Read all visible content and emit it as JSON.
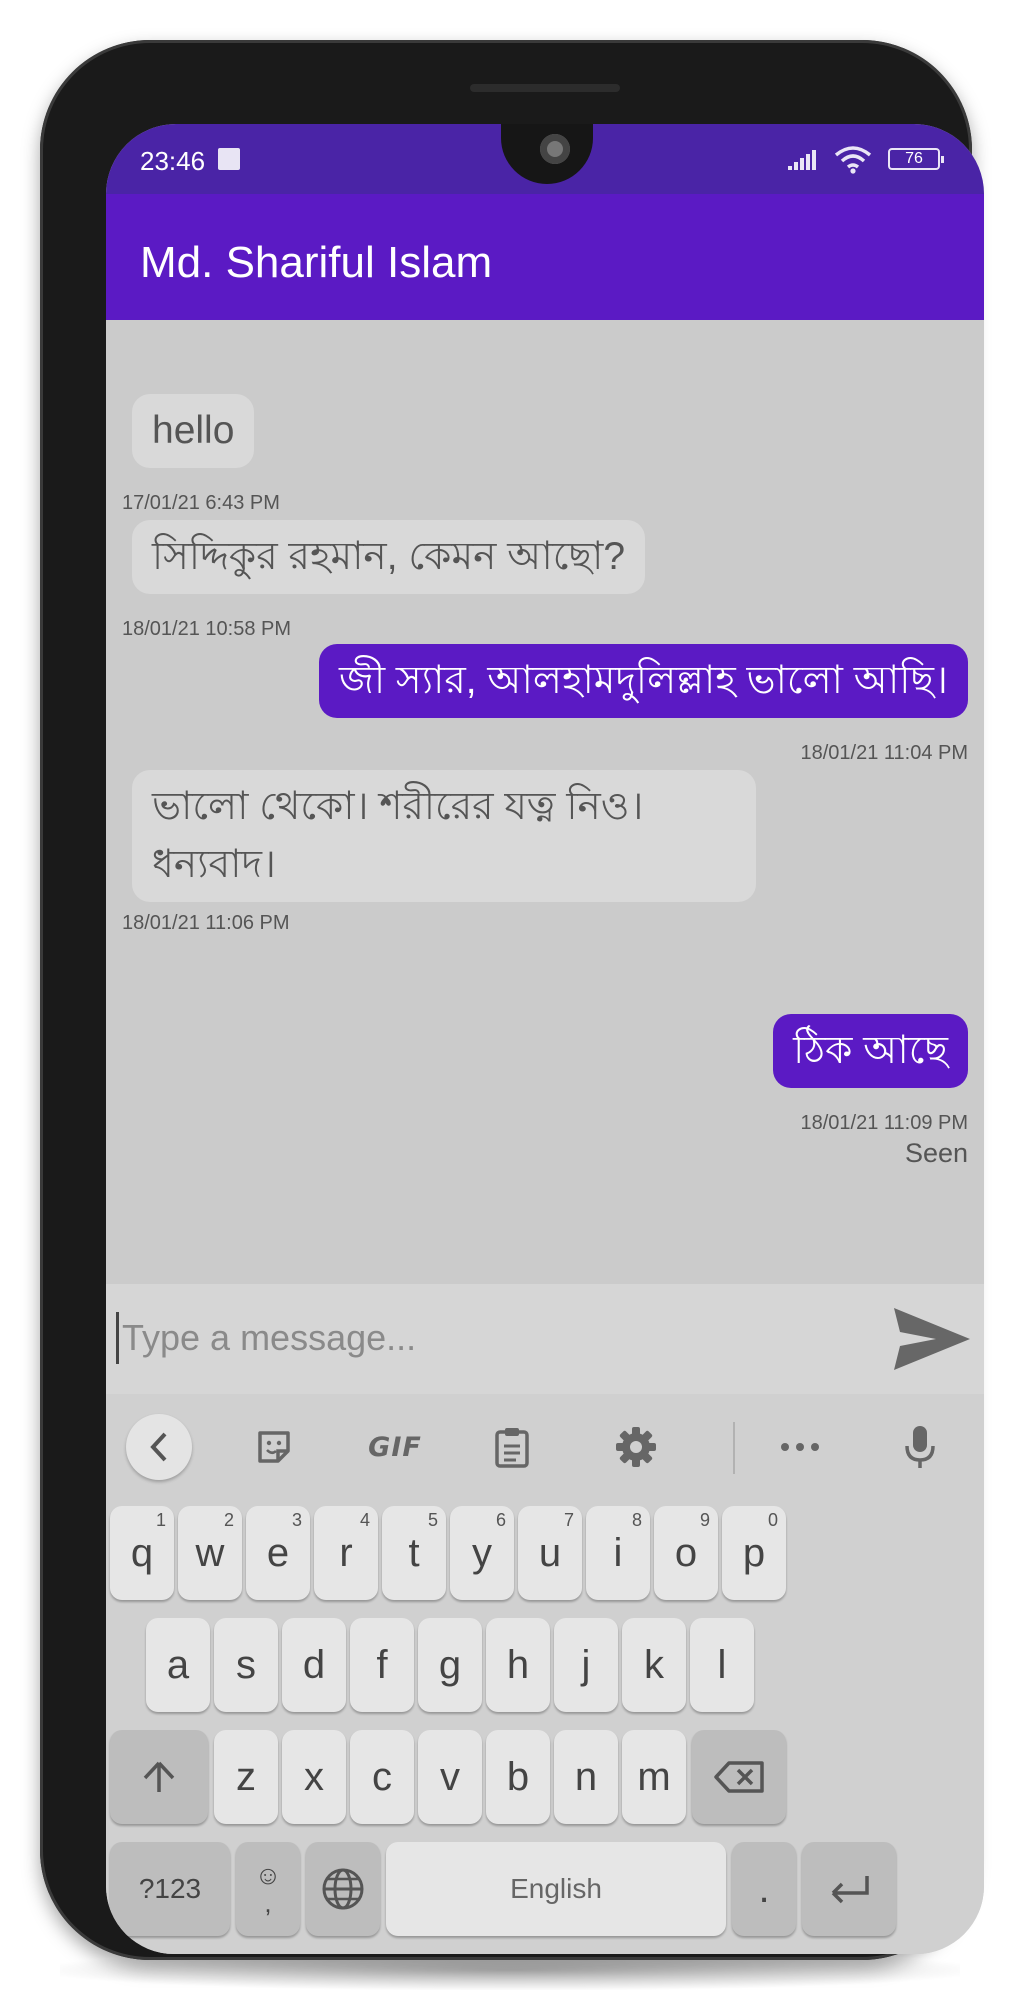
{
  "status_bar": {
    "time": "23:46",
    "battery": "76"
  },
  "app_bar": {
    "title": "Md. Shariful Islam"
  },
  "messages": [
    {
      "direction": "in",
      "text": "hello",
      "time": "17/01/21 6:43 PM"
    },
    {
      "direction": "in",
      "text": "সিদ্দিকুর রহমান, কেমন আছো?",
      "time": "18/01/21 10:58 PM"
    },
    {
      "direction": "out",
      "text": "জী স্যার, আলহামদুলিল্লাহ ভালো আছি।",
      "time": "18/01/21 11:04 PM"
    },
    {
      "direction": "in",
      "text_line1": "ভালো থেকো। শরীরের যত্ন নিও।",
      "text_line2": "ধন্যবাদ।",
      "time": "18/01/21 11:06 PM"
    },
    {
      "direction": "out",
      "text": "ঠিক আছে",
      "time": "18/01/21 11:09 PM",
      "status": "Seen"
    }
  ],
  "composer": {
    "placeholder": "Type a message...",
    "value": ""
  },
  "keyboard": {
    "toolbar": {
      "gif_label": "GIF"
    },
    "row1": [
      "q",
      "w",
      "e",
      "r",
      "t",
      "y",
      "u",
      "i",
      "o",
      "p"
    ],
    "row1_hints": [
      "1",
      "2",
      "3",
      "4",
      "5",
      "6",
      "7",
      "8",
      "9",
      "0"
    ],
    "row2": [
      "a",
      "s",
      "d",
      "f",
      "g",
      "h",
      "j",
      "k",
      "l"
    ],
    "row3": [
      "z",
      "x",
      "c",
      "v",
      "b",
      "n",
      "m"
    ],
    "symbols_label": "?123",
    "comma_label": ",",
    "space_label": "English",
    "period_label": "."
  },
  "colors": {
    "primary": "#5b1ac4",
    "status_bar": "#4a24a6",
    "incoming_bubble": "#d9d9d9",
    "chat_background": "#cbcbcb"
  }
}
